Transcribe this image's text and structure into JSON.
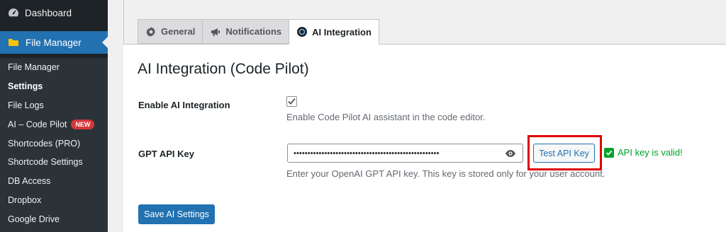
{
  "sidebar": {
    "dashboard_label": "Dashboard",
    "file_manager_label": "File Manager",
    "items": [
      {
        "label": "File Manager"
      },
      {
        "label": "Settings"
      },
      {
        "label": "File Logs"
      },
      {
        "label": "AI – Code Pilot",
        "badge": "NEW"
      },
      {
        "label": "Shortcodes (PRO)"
      },
      {
        "label": "Shortcode Settings"
      },
      {
        "label": "DB Access"
      },
      {
        "label": "Dropbox"
      },
      {
        "label": "Google Drive"
      }
    ]
  },
  "tabs": [
    {
      "label": "General",
      "icon": "gear-icon"
    },
    {
      "label": "Notifications",
      "icon": "megaphone-icon"
    },
    {
      "label": "AI Integration",
      "icon": "openai-icon",
      "active": true
    }
  ],
  "page": {
    "heading": "AI Integration (Code Pilot)",
    "enable_label": "Enable AI Integration",
    "enable_checked": true,
    "enable_desc": "Enable Code Pilot AI assistant in the code editor.",
    "api_key_label": "GPT API Key",
    "api_key_value": "••••••••••••••••••••••••••••••••••••••••••••••••••••",
    "api_key_desc": "Enter your OpenAI GPT API key. This key is stored only for your user account.",
    "test_button": "Test API Key",
    "status_text": "API key is valid!",
    "save_button": "Save AI Settings"
  },
  "colors": {
    "accent": "#2271b1",
    "success": "#00a32a",
    "highlight": "#e00000",
    "sidebar_bg": "#1d2327"
  }
}
